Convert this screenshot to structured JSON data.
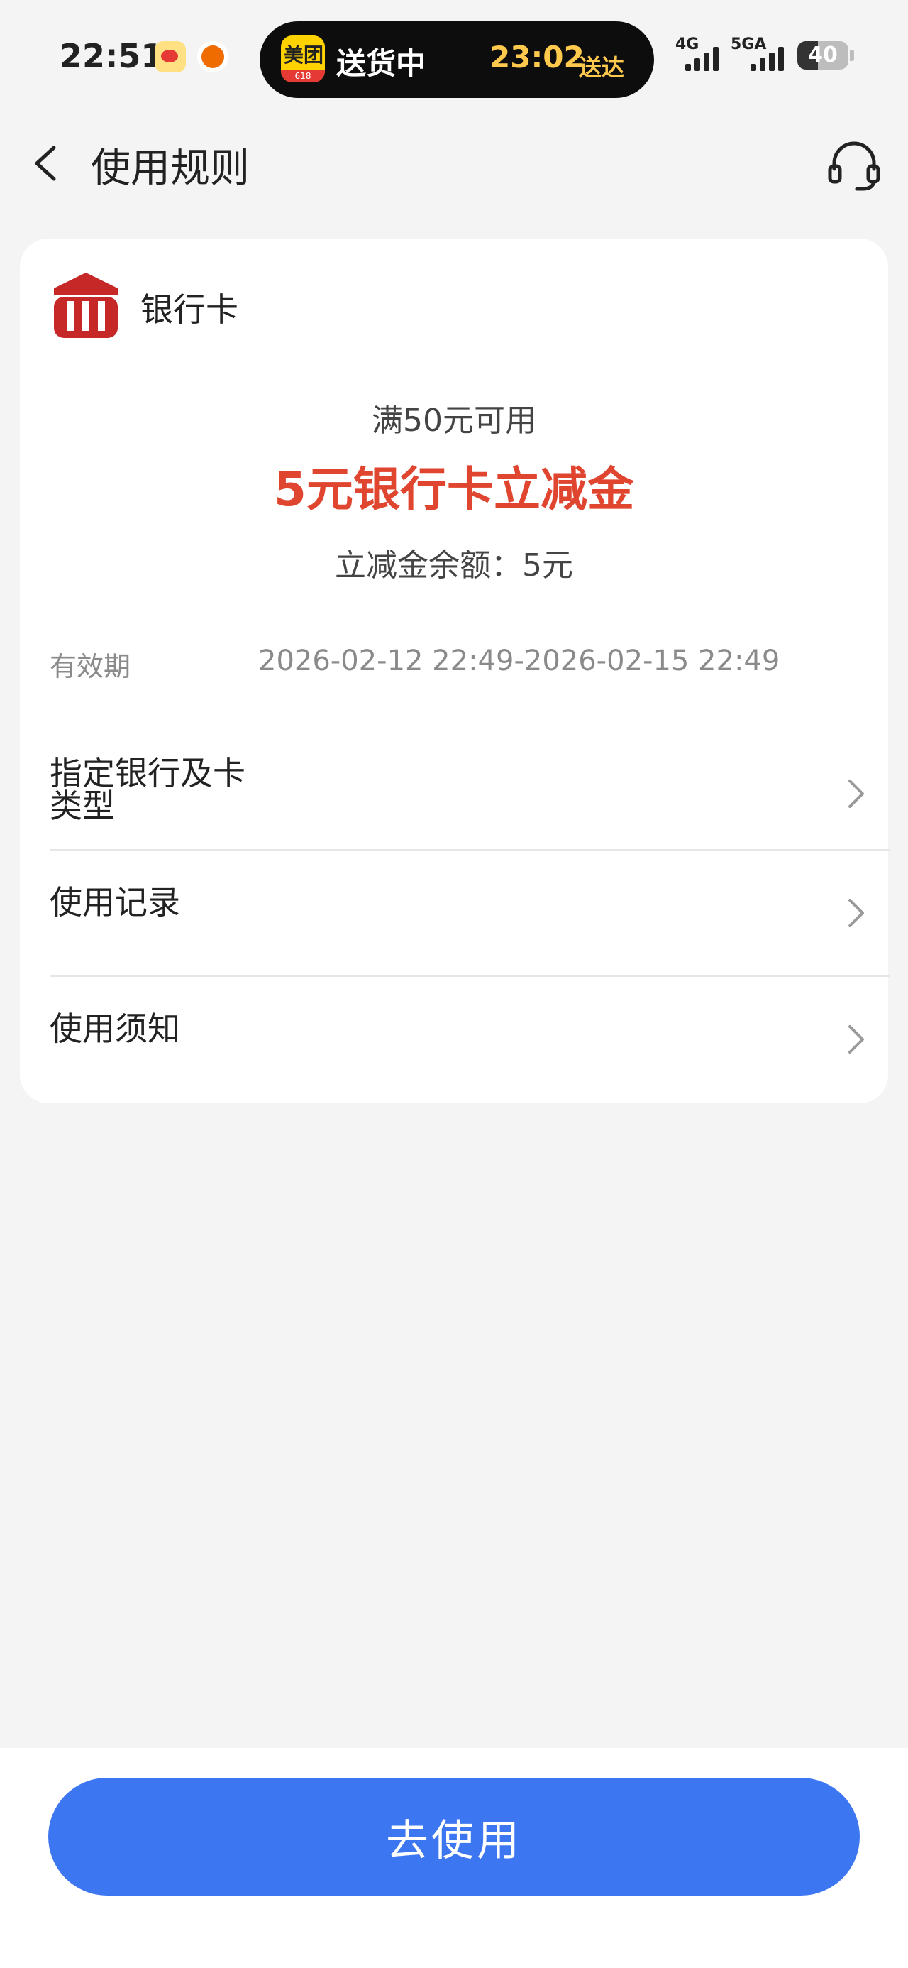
{
  "status_bar": {
    "time": "22:51",
    "island": {
      "app_logo_text": "美团",
      "app_logo_sub": "618",
      "status_text": "送货中",
      "eta_time": "23:02",
      "eta_suffix": "送达"
    },
    "network_1": "4G",
    "network_2": "5GA",
    "battery_level": "40"
  },
  "header": {
    "title": "使用规则",
    "back_icon": "chevron-left-icon",
    "service_icon": "headset-icon"
  },
  "coupon": {
    "bank_name": "银行卡",
    "threshold": "满50元可用",
    "title": "5元银行卡立减金",
    "balance": "立减金余额：5元",
    "validity_label": "有效期",
    "validity_value": "2026-02-12 22:49-2026-02-15 22:49",
    "title_color": "#e0452f"
  },
  "rows": {
    "bank_type_line1": "指定银行及卡",
    "bank_type_line2": "类型",
    "usage_record": "使用记录",
    "usage_notice": "使用须知"
  },
  "footer": {
    "cta_label": "去使用",
    "cta_color": "#3c76f0"
  }
}
